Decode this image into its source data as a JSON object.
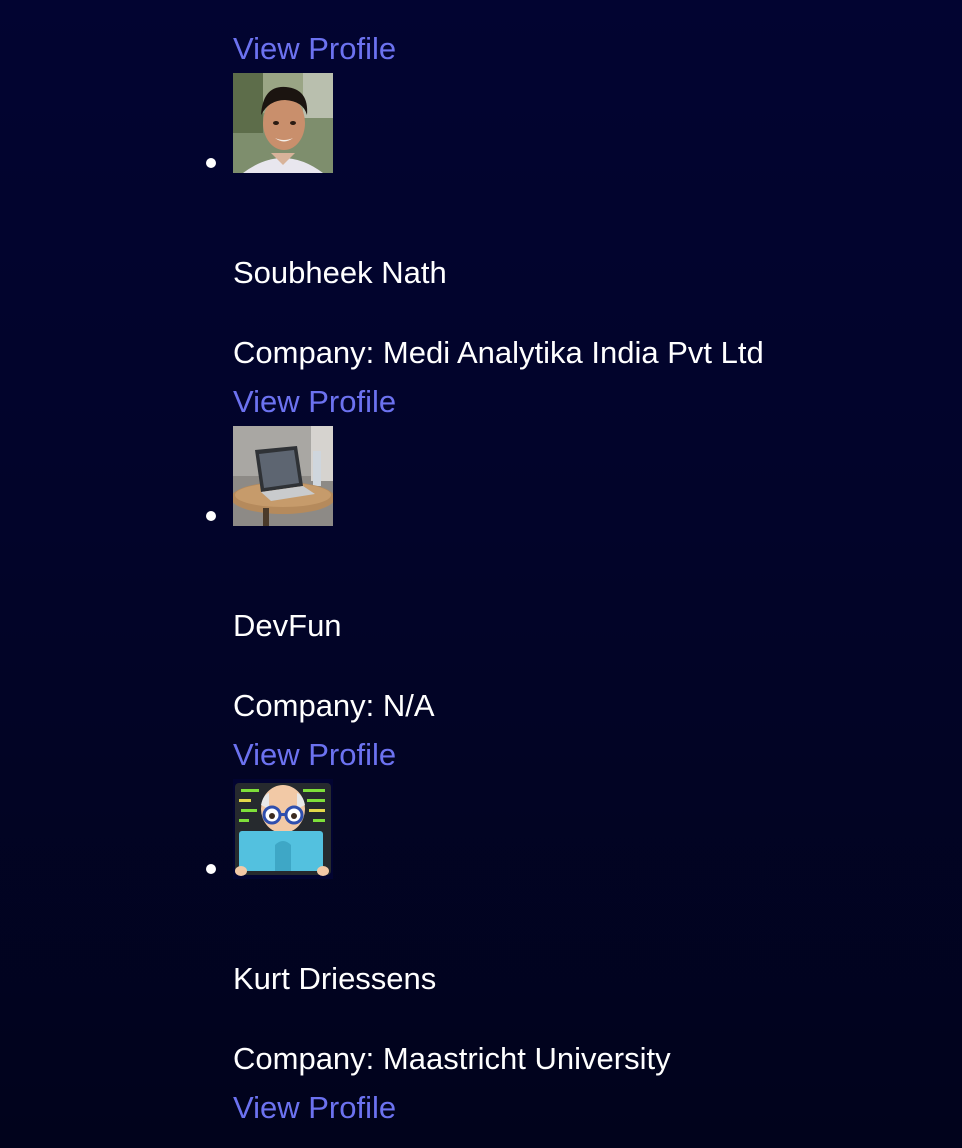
{
  "top_link": {
    "label": "View Profile"
  },
  "profiles": [
    {
      "name": "Soubheek Nath",
      "company": "Company: Medi Analytika India Pvt Ltd",
      "link_label": "View Profile",
      "avatar": "person-photo"
    },
    {
      "name": "DevFun",
      "company": "Company: N/A",
      "link_label": "View Profile",
      "avatar": "laptop-photo"
    },
    {
      "name": "Kurt Driessens",
      "company": "Company: Maastricht University",
      "link_label": "View Profile",
      "avatar": "coder-emoji"
    }
  ],
  "colors": {
    "background": "#020431",
    "text": "#ffffff",
    "link": "#6c72f0"
  }
}
